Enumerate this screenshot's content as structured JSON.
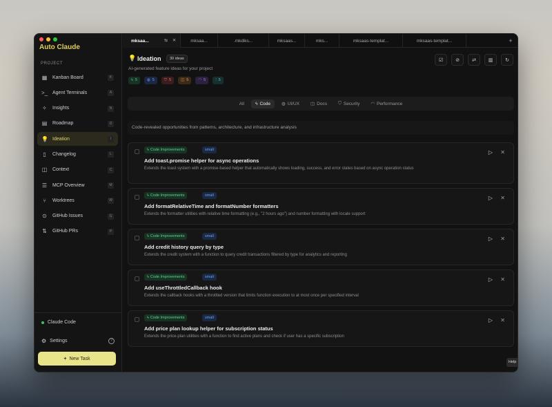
{
  "app": {
    "title": "Auto Claude"
  },
  "sidebar": {
    "section_label": "PROJECT",
    "items": [
      {
        "label": "Kanban Board",
        "shortcut": "K",
        "icon": "kanban-icon",
        "active": false
      },
      {
        "label": "Agent Terminals",
        "shortcut": "A",
        "icon": "terminal-icon",
        "active": false
      },
      {
        "label": "Insights",
        "shortcut": "N",
        "icon": "sparkles-icon",
        "active": false
      },
      {
        "label": "Roadmap",
        "shortcut": "D",
        "icon": "map-icon",
        "active": false
      },
      {
        "label": "Ideation",
        "shortcut": "I",
        "icon": "lightbulb-icon",
        "active": true
      },
      {
        "label": "Changelog",
        "shortcut": "L",
        "icon": "document-icon",
        "active": false
      },
      {
        "label": "Context",
        "shortcut": "C",
        "icon": "book-icon",
        "active": false
      },
      {
        "label": "MCP Overview",
        "shortcut": "M",
        "icon": "server-icon",
        "active": false
      },
      {
        "label": "Worktrees",
        "shortcut": "W",
        "icon": "branch-icon",
        "active": false
      },
      {
        "label": "GitHub Issues",
        "shortcut": "G",
        "icon": "issue-icon",
        "active": false
      },
      {
        "label": "GitHub PRs",
        "shortcut": "P",
        "icon": "pull-request-icon",
        "active": false
      }
    ],
    "claude_code_label": "Claude Code",
    "settings_label": "Settings",
    "new_task_label": "New Task"
  },
  "tabs": [
    {
      "label": "mksaa...",
      "active": true
    },
    {
      "label": "mksaa...",
      "active": false
    },
    {
      "label": ".mkdiks...",
      "active": false
    },
    {
      "label": "mksaas...",
      "active": false
    },
    {
      "label": "mks...",
      "active": false
    },
    {
      "label": "mksaas-templat...",
      "active": false
    },
    {
      "label": "mksaas-templat...",
      "active": false
    }
  ],
  "header": {
    "title": "Ideation",
    "ideas_count": "30 ideas",
    "subtitle": "AI-generated feature ideas for your project",
    "stats": [
      {
        "icon": "zap-icon",
        "value": "5",
        "color": "#4fd08a",
        "bg": "#173326"
      },
      {
        "icon": "palette-icon",
        "value": "5",
        "color": "#6f9dfb",
        "bg": "#1b2844"
      },
      {
        "icon": "shield-icon",
        "value": "5",
        "color": "#f06a6a",
        "bg": "#3a1d1d"
      },
      {
        "icon": "book-icon",
        "value": "5",
        "color": "#f0a24a",
        "bg": "#3a2a17"
      },
      {
        "icon": "gauge-icon",
        "value": "5",
        "color": "#b07af0",
        "bg": "#2d2140"
      },
      {
        "icon": "bars-icon",
        "value": "5",
        "color": "#42c7c7",
        "bg": "#17302f"
      }
    ]
  },
  "filters": [
    {
      "label": "All",
      "icon": "",
      "active": false
    },
    {
      "label": "Code",
      "icon": "zap-icon",
      "active": true
    },
    {
      "label": "UI/UX",
      "icon": "palette-icon",
      "active": false
    },
    {
      "label": "Docs",
      "icon": "book-icon",
      "active": false
    },
    {
      "label": "Security",
      "icon": "shield-icon",
      "active": false
    },
    {
      "label": "Performance",
      "icon": "gauge-icon",
      "active": false
    }
  ],
  "category_description": "Code-revealed opportunities from patterns, architecture, and infrastructure analysis",
  "ideas": [
    {
      "category": "Code Improvements",
      "size": "small",
      "title": "Add toast.promise helper for async operations",
      "description": "Extends the toast system with a promise-based helper that automatically shows loading, success, and error states based on async operation status"
    },
    {
      "category": "Code Improvements",
      "size": "small",
      "title": "Add formatRelativeTime and formatNumber formatters",
      "description": "Extends the formatter utilities with relative time formatting (e.g., \"2 hours ago\") and number formatting with locale support"
    },
    {
      "category": "Code Improvements",
      "size": "small",
      "title": "Add credit history query by type",
      "description": "Extends the credit system with a function to query credit transactions filtered by type for analytics and reporting"
    },
    {
      "category": "Code Improvements",
      "size": "small",
      "title": "Add useThrottledCallback hook",
      "description": "Extends the callback hooks with a throttled version that limits function execution to at most once per specified interval"
    },
    {
      "category": "Code Improvements",
      "size": "small",
      "title": "Add price plan lookup helper for subscription status",
      "description": "Extends the price-plan utilities with a function to find active plans and check if user has a specific subscription"
    }
  ],
  "help_tab_label": "Help"
}
